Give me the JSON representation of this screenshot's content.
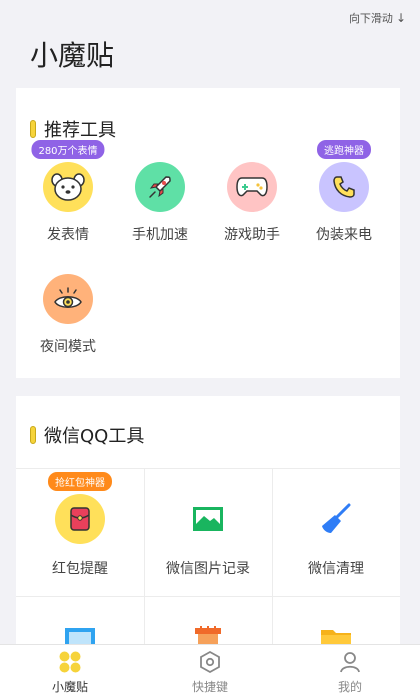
{
  "header": {
    "scroll_hint": "向下滑动",
    "app_title": "小魔贴"
  },
  "recommended": {
    "title": "推荐工具",
    "tools": [
      {
        "label": "发表情",
        "badge": "280万个表情",
        "icon": "dog-face-icon",
        "bg": "#ffe05a"
      },
      {
        "label": "手机加速",
        "badge": "",
        "icon": "rocket-icon",
        "bg": "#5fe0a6"
      },
      {
        "label": "游戏助手",
        "badge": "",
        "icon": "gamepad-icon",
        "bg": "#ffc4c4"
      },
      {
        "label": "伪装来电",
        "badge": "逃跑神器",
        "icon": "phone-icon",
        "bg": "#c9c4ff"
      },
      {
        "label": "夜间模式",
        "badge": "",
        "icon": "eye-icon",
        "bg": "#ffb27a"
      }
    ]
  },
  "wechat_qq": {
    "title": "微信QQ工具",
    "tools": [
      {
        "label": "红包提醒",
        "badge": "抢红包神器",
        "icon": "red-envelope-icon",
        "bg": "#ffe05a"
      },
      {
        "label": "微信图片记录",
        "badge": "",
        "icon": "image-icon",
        "bg": "#ffffff"
      },
      {
        "label": "微信清理",
        "badge": "",
        "icon": "broom-icon",
        "bg": "#ffffff"
      }
    ]
  },
  "tabbar": {
    "tabs": [
      {
        "label": "小魔贴",
        "icon": "grid-dots-icon",
        "active": true
      },
      {
        "label": "快捷键",
        "icon": "hexagon-icon",
        "active": false
      },
      {
        "label": "我的",
        "icon": "person-icon",
        "active": false
      }
    ]
  },
  "colors": {
    "accent_yellow": "#f6d33a",
    "badge_purple": "#8f63e6",
    "badge_orange": "#ff8a1a",
    "background": "#f2f2f6"
  }
}
